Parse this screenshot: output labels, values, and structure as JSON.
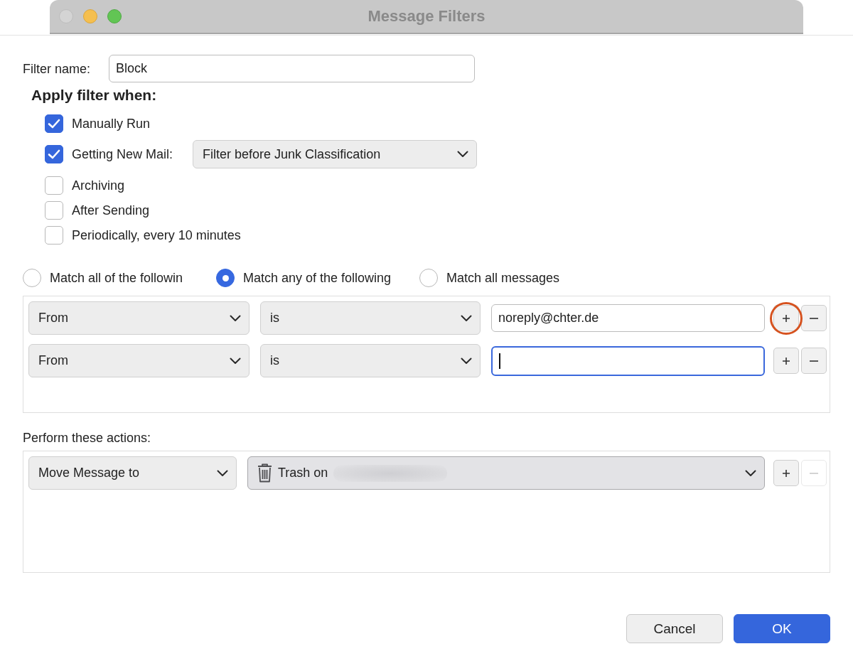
{
  "window": {
    "title": "Message Filters"
  },
  "filter_name": {
    "label": "Filter name:",
    "value": "Block"
  },
  "apply_when": {
    "heading": "Apply filter when:",
    "options": [
      {
        "label": "Manually Run",
        "checked": true
      },
      {
        "label": "Getting New Mail:",
        "checked": true,
        "dropdown": "Filter before Junk Classification"
      },
      {
        "label": "Archiving",
        "checked": false
      },
      {
        "label": "After Sending",
        "checked": false
      },
      {
        "label": "Periodically, every 10 minutes",
        "checked": false
      }
    ]
  },
  "match_modes": [
    {
      "label": "Match all of the followin",
      "selected": false
    },
    {
      "label": "Match any of the following",
      "selected": true
    },
    {
      "label": "Match all messages",
      "selected": false
    }
  ],
  "rules": [
    {
      "field": "From",
      "operator": "is",
      "value": "noreply@chter.de",
      "focused": false,
      "annotated": true,
      "remove_disabled": false
    },
    {
      "field": "From",
      "operator": "is",
      "focused": true,
      "annotated": false,
      "remove_disabled": false
    }
  ],
  "actions_label": "Perform these actions:",
  "actions": [
    {
      "action": "Move Message to",
      "target": "Trash on",
      "target_redacted": true,
      "remove_disabled": true
    }
  ],
  "buttons": [
    {
      "label": "Cancel",
      "kind": "secondary"
    },
    {
      "label": "OK",
      "kind": "primary"
    }
  ]
}
